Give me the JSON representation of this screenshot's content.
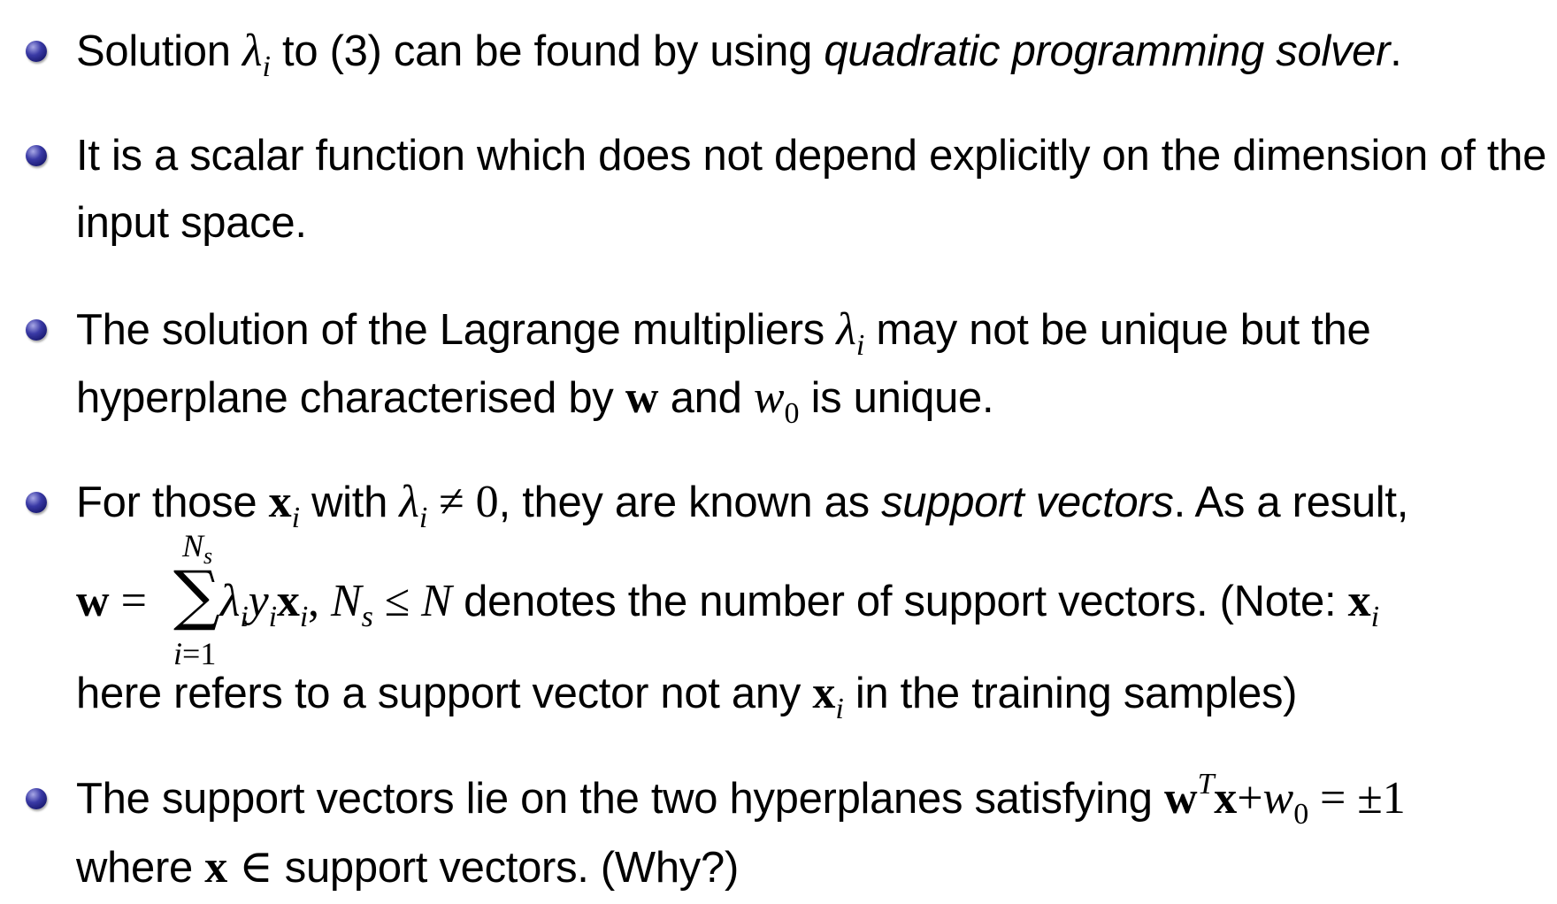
{
  "bullets": [
    {
      "lines": [
        {
          "a": "Solution ",
          "lambda": "λ",
          "lambda_sub": "i",
          "b": " to (3) can be found by using ",
          "em": "quadratic programming solver",
          "c": "."
        }
      ]
    },
    {
      "lines": [
        {
          "text": "It is a scalar function which does not depend explicitly on the dimension of the"
        },
        {
          "text": "input space."
        }
      ]
    },
    {
      "lines": [
        {
          "a": "The solution of the Lagrange multipliers ",
          "lambda": "λ",
          "lambda_sub": "i",
          "b": " may not be unique but the"
        },
        {
          "a": "hyperplane characterised by ",
          "w": "w",
          "b": " and ",
          "w0": "w",
          "w0_sub": "0",
          "c": " is unique."
        }
      ]
    },
    {
      "lines": [
        {
          "a": "For those ",
          "x": "x",
          "x_sub": "i",
          "b": " with ",
          "lambda": "λ",
          "lambda_sub": "i",
          "neq": " ≠ 0",
          "c": ", they are known as ",
          "em": "support vectors",
          "d": ". As a result,"
        },
        {
          "w": "w",
          "eq": " = ",
          "sum_upper": "N",
          "sum_upper_sub": "s",
          "sum_sign": "∑",
          "sum_lower_var": "i",
          "sum_lower_rest": "=1",
          "lambda": "λ",
          "lambda_sub": "i",
          "y": "y",
          "y_sub": "i",
          "x": "x",
          "x_sub": "i",
          "comma": ", ",
          "N": "N",
          "N_sub": "s",
          "leq": " ≤ ",
          "N2": "N",
          "a": " denotes the number of support vectors. (Note: ",
          "x2": "x",
          "x2_sub": "i"
        },
        {
          "a": "here refers to a support vector not any ",
          "x": "x",
          "x_sub": "i",
          "b": " in the training samples)"
        }
      ]
    },
    {
      "lines": [
        {
          "a": "The support vectors lie on the two hyperplanes satisfying ",
          "w": "w",
          "T": "T",
          "x": "x",
          "plus": "+",
          "w0": "w",
          "w0_sub": "0",
          "eq": " = ±1"
        },
        {
          "a": "where ",
          "x": "x",
          "in": " ∈ ",
          "b": "support vectors. (Why?)"
        }
      ]
    }
  ]
}
